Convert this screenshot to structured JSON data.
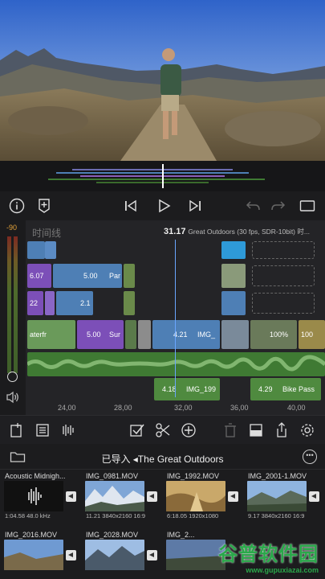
{
  "timeline": {
    "title": "时间线",
    "timecode": "31.17",
    "project_info": "Great Outdoors (30 fps, SDR-10bit) 时...",
    "meter_level": "-90",
    "ruler_ticks": [
      "24,00",
      "28,00",
      "32,00",
      "36,00",
      "40,00"
    ],
    "clips": {
      "c1": "6.07",
      "c2": "5.00",
      "c2b": "Par",
      "c3": "22",
      "c4": "2.1",
      "c5": "aterfr",
      "c6": "5.00",
      "c6b": "Sur",
      "c7": "4.21",
      "c7b": "IMG_",
      "c8": "100%",
      "c9": "100"
    },
    "audio_clips": {
      "a1": "4.18",
      "a1b": "IMG_199",
      "a2": "4.29",
      "a2b": "Bike Pass"
    }
  },
  "browser": {
    "title": "已导入 ◂The Great Outdoors",
    "more_label": "•••",
    "items": [
      {
        "name": "Acoustic Midnigh...",
        "meta": "1:04.58  48.0 kHz"
      },
      {
        "name": "IMG_0981.MOV",
        "meta": "11.21  3840x2160  16:9"
      },
      {
        "name": "IMG_1992.MOV",
        "meta": "6:18.05  1920x1080"
      },
      {
        "name": "IMG_2001-1.MOV",
        "meta": "9.17  3840x2160  16:9"
      },
      {
        "name": "IMG_2016.MOV",
        "meta": ""
      },
      {
        "name": "IMG_2028.MOV",
        "meta": ""
      },
      {
        "name": "IMG_2...",
        "meta": ""
      }
    ]
  },
  "watermark": {
    "big": "谷普软件园",
    "small": "www.gupuxiazai.com"
  },
  "colors": {
    "accent": "#6aa6ff",
    "clip_purple": "#7c4fb8",
    "clip_blue": "#4e7fb5",
    "audio_green": "#3f7a33"
  }
}
